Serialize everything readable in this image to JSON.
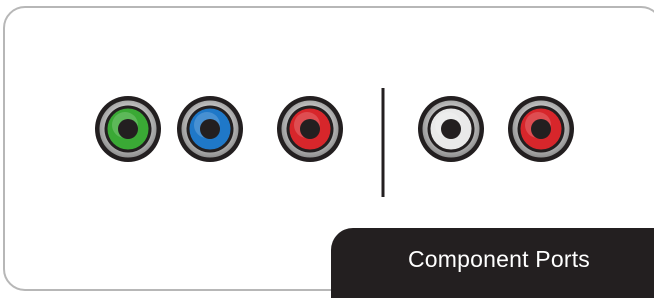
{
  "label": {
    "text": "Component Ports"
  },
  "ports": [
    {
      "name": "port-green",
      "color": "#3aa935"
    },
    {
      "name": "port-blue",
      "color": "#1f78c8"
    },
    {
      "name": "port-red-1",
      "color": "#d7262b"
    },
    {
      "name": "port-white",
      "color": "#e9e9e9"
    },
    {
      "name": "port-red-2",
      "color": "#d7262b"
    }
  ],
  "colors": {
    "panel_border": "#b7b7b7",
    "label_background": "#231f20",
    "label_text": "#ffffff",
    "port_housing": "#231f20",
    "divider": "#231f20"
  }
}
